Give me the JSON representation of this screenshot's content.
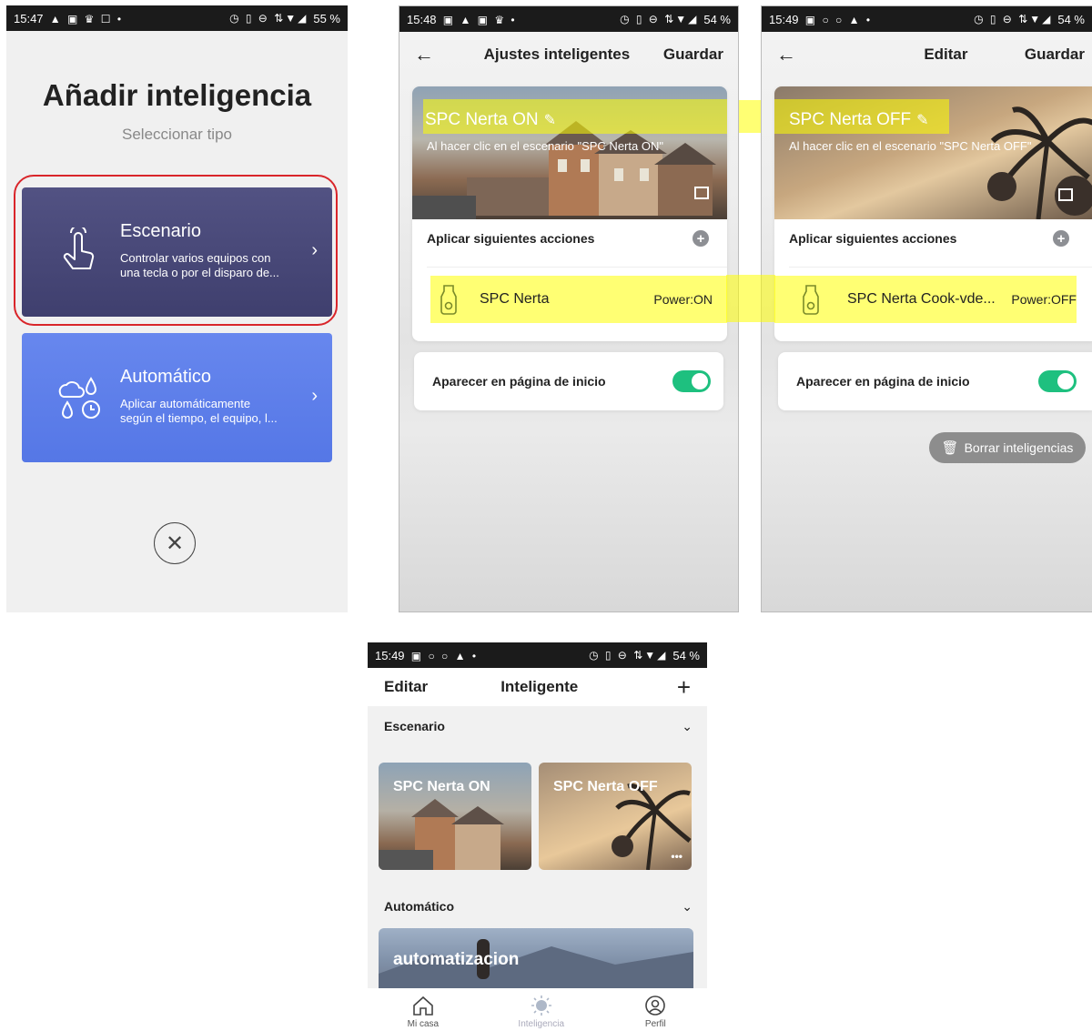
{
  "status1": {
    "time": "15:47",
    "icons": "▲ ▣ ♛ ☐ •",
    "right_icons": "◷ ▯ ⊖ ⇅▼◢",
    "battery": "55 %"
  },
  "status2": {
    "time": "15:48",
    "icons": "▣ ▲ ▣ ♛ •",
    "right_icons": "◷ ▯ ⊖ ⇅▼◢",
    "battery": "54 %"
  },
  "status3": {
    "time": "15:49",
    "icons": "▣ ○ ○ ▲ •",
    "right_icons": "◷ ▯ ⊖ ⇅▼◢",
    "battery": "54 %"
  },
  "status4": {
    "time": "15:49",
    "icons": "▣ ○ ○ ▲ •",
    "right_icons": "◷ ▯ ⊖ ⇅▼◢",
    "battery": "54 %"
  },
  "screen1": {
    "title": "Añadir inteligencia",
    "subtitle": "Seleccionar tipo",
    "scene_title": "Escenario",
    "scene_desc_1": "Controlar varios equipos con",
    "scene_desc_2": "una tecla o por el disparo de...",
    "auto_title": "Automático",
    "auto_desc_1": "Aplicar automáticamente",
    "auto_desc_2": "según el tiempo, el equipo, l..."
  },
  "screen2": {
    "nav_title": "Ajustes inteligentes",
    "save": "Guardar",
    "scene_name": "SPC Nerta ON",
    "scene_desc": "Al hacer clic en el escenario \"SPC Nerta ON\"",
    "actions_label": "Aplicar siguientes acciones",
    "device_name": "SPC Nerta",
    "device_state": "Power:ON",
    "home_label": "Aparecer en página de inicio"
  },
  "screen3": {
    "nav_title": "Editar",
    "save": "Guardar",
    "scene_name": "SPC Nerta OFF",
    "scene_desc": "Al hacer clic en el escenario \"SPC Nerta OFF\"",
    "actions_label": "Aplicar siguientes acciones",
    "device_name": "SPC Nerta Cook-vde...",
    "device_state": "Power:OFF",
    "home_label": "Aparecer en página de inicio",
    "delete_label": "Borrar inteligencias"
  },
  "screen4": {
    "edit": "Editar",
    "nav_title": "Inteligente",
    "add": "+",
    "section_scene": "Escenario",
    "tile_on": "SPC Nerta ON",
    "tile_off": "SPC Nerta OFF",
    "more": "•••",
    "section_auto": "Automático",
    "auto_tile": "automatizacion",
    "tab_home": "Mi casa",
    "tab_smart": "Inteligencia",
    "tab_profile": "Perfil"
  },
  "colors": {
    "scene_card": "#4a4a7c",
    "auto_card": "#5a7ded",
    "toggle": "#1ec07f",
    "highlight": "#ffff00",
    "annotation": "#d9252a"
  }
}
